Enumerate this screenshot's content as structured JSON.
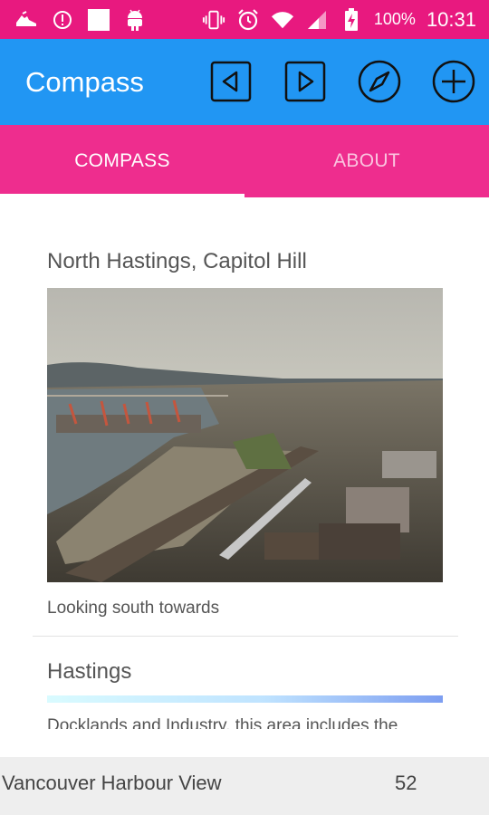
{
  "status_bar": {
    "battery": "100%",
    "time": "10:31",
    "icons": [
      "shoe-icon",
      "info-circle-icon",
      "white-square-icon",
      "android-icon",
      "vibrate-icon",
      "alarm-icon",
      "wifi-icon",
      "signal-icon",
      "battery-charging-icon"
    ]
  },
  "app_bar": {
    "title": "Compass",
    "actions": [
      "previous-icon",
      "next-icon",
      "compass-icon",
      "add-icon"
    ]
  },
  "tabs": [
    {
      "label": "COMPASS",
      "active": true
    },
    {
      "label": "ABOUT",
      "active": false
    }
  ],
  "content": {
    "location_title": "North Hastings, Capitol Hill",
    "caption": "Looking south towards",
    "section_title": "Hastings",
    "description": "Docklands and Industry, this area includes the"
  },
  "bottom_bar": {
    "title": "Vancouver Harbour View",
    "count": "52"
  },
  "colors": {
    "status_bar": "#e8197f",
    "app_bar": "#2196f3",
    "tab_bar": "#ee2d8e",
    "bottom_bar": "#eeeeee"
  }
}
